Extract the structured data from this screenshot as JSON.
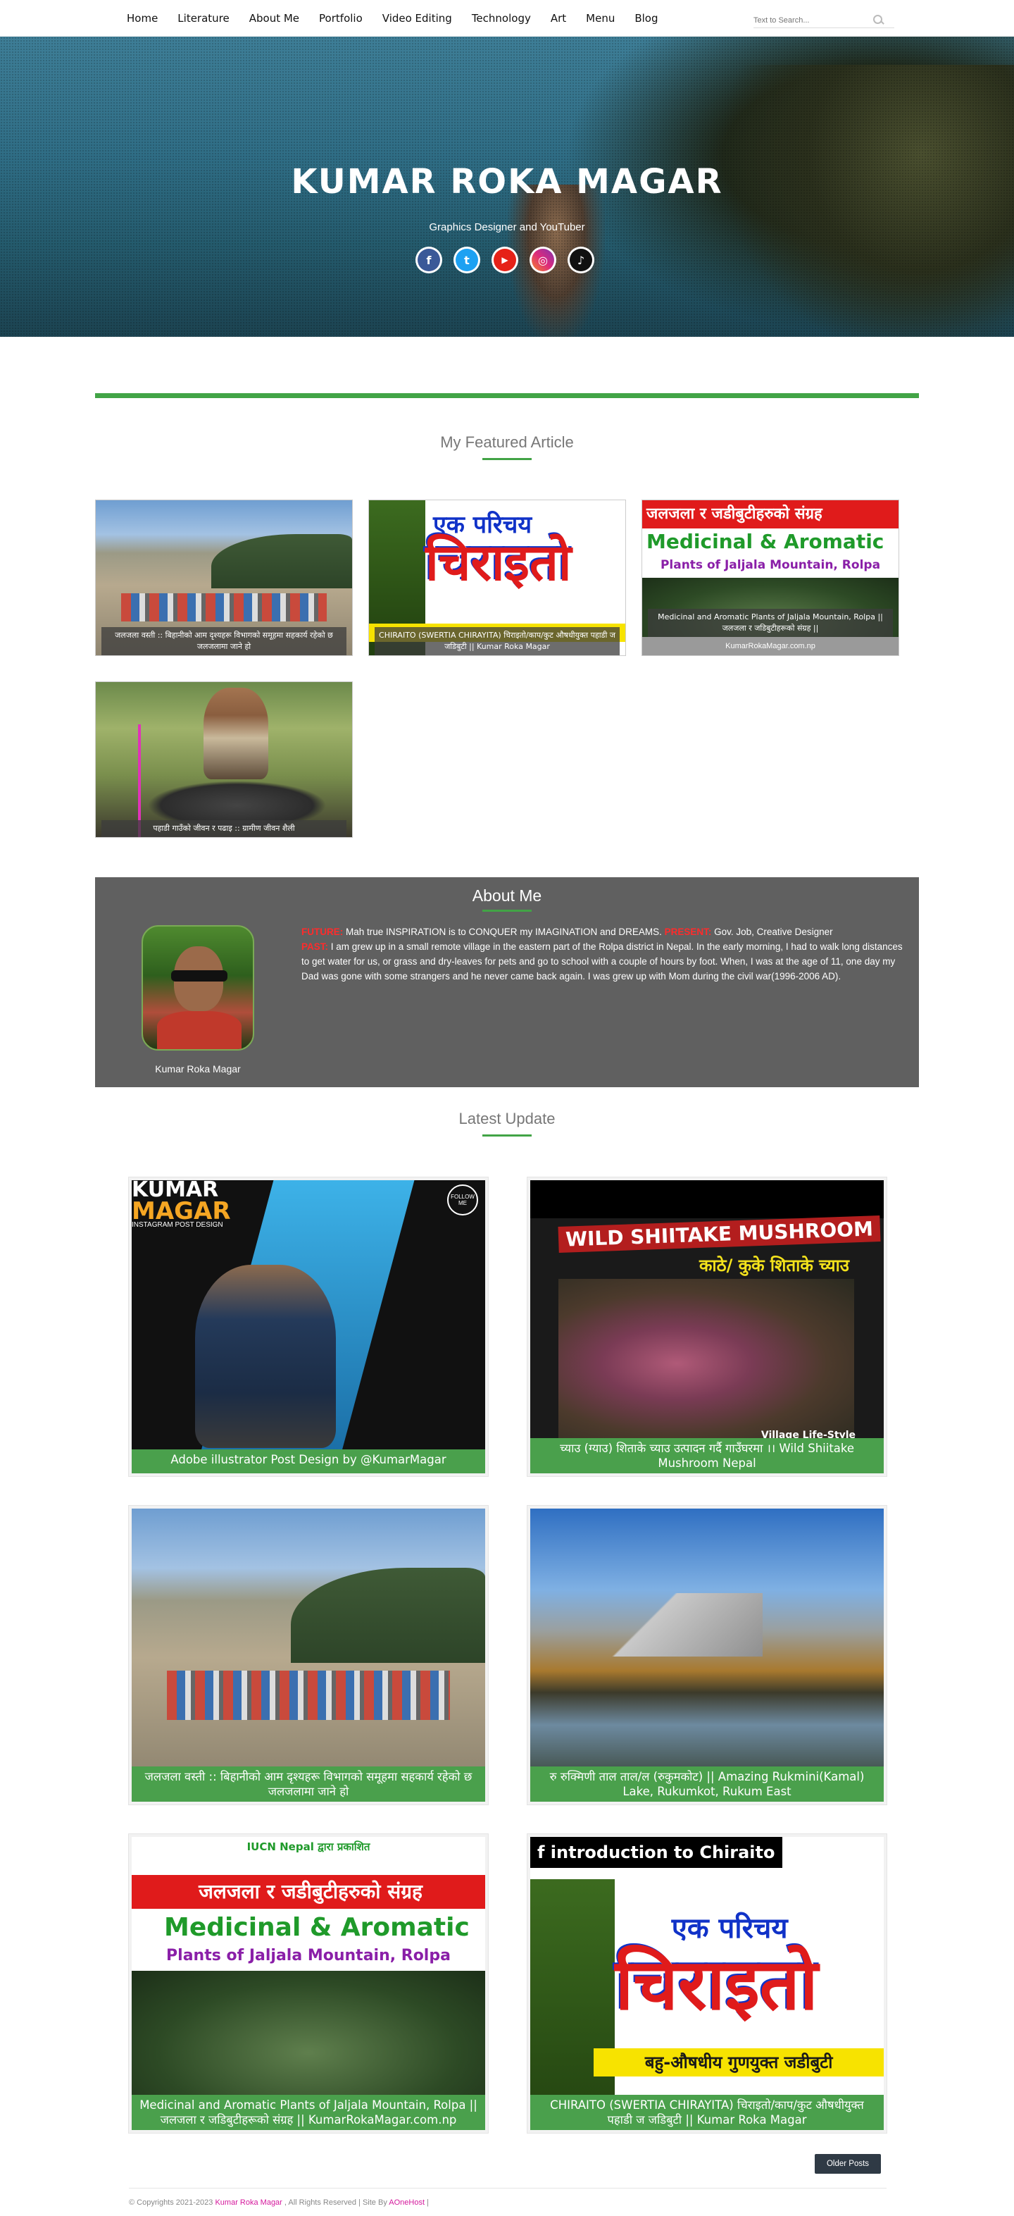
{
  "nav": {
    "items": [
      "Home",
      "Literature",
      "About Me",
      "Portfolio",
      "Video Editing",
      "Technology",
      "Art",
      "Menu",
      "Blog"
    ],
    "search_placeholder": "Text to Search..."
  },
  "hero": {
    "title": "KUMAR ROKA MAGAR",
    "tagline": "Graphics Designer and YouTuber",
    "socials": [
      {
        "name": "facebook",
        "glyph": "f",
        "color": "#3b5998"
      },
      {
        "name": "twitter",
        "glyph": "t",
        "color": "#1da1f2"
      },
      {
        "name": "youtube",
        "glyph": "▶",
        "color": "#e62117"
      },
      {
        "name": "instagram",
        "glyph": "◎",
        "color": "#c13584"
      },
      {
        "name": "tiktok",
        "glyph": "♪",
        "color": "#111111"
      }
    ]
  },
  "featured": {
    "title": "My Featured Article",
    "cards": [
      {
        "caption": "जलजला वस्ती :: बिहानीको आम दृश्यहरू विभागको समूहमा सहकार्य रहेको छ जलजलामा जाने हो"
      },
      {
        "caption": "CHIRAITO (SWERTIA CHIRAYITA) चिराइतो/काप/कुट औषधीयुक्त पहाडी ज जडिबुटी || Kumar Roka Magar"
      },
      {
        "caption": "Medicinal and Aromatic Plants of Jaljala Mountain, Rolpa || जलजला र जडिबुटीहरूको संग्रह ||",
        "url": "KumarRokaMagar.com.np",
        "banner": "जलजला र जडीबुटीहरुको संग्रह",
        "heading": "Medicinal & Aromatic",
        "subheading": "Plants of Jaljala Mountain, Rolpa"
      },
      {
        "caption": "पहाडी गाउँको जीवन र पढाइ :: ग्रामीण जीवन शैली"
      }
    ],
    "chiraito_top": "एक परिचय",
    "chiraito_big": "चिराइतो"
  },
  "about": {
    "title": "About Me",
    "name": "Kumar Roka Magar",
    "future_label": "FUTURE:",
    "future_text": " Mah true INSPIRATION is to CONQUER my IMAGINATION and DREAMS. ",
    "present_label": "PRESENT:",
    "present_text": " Gov. Job, Creative Designer ",
    "past_label": "PAST:",
    "past_text": " I am grew up in a small remote village in the eastern part of the Rolpa district in Nepal. In the early morning, I had to walk long distances to get water for us, or grass and dry-leaves for pets and go to school with a couple of hours by foot. When, I was at the age of 11, one day my Dad was gone with some strangers and he never came back again. I was grew up with Mom during the civil war(1996-2006 AD)."
  },
  "latest": {
    "title": "Latest Update",
    "posts": [
      {
        "caption": "Adobe illustrator Post Design by @KumarMagar",
        "kumar": "KUMAR",
        "magar": "MAGAR",
        "sub": "INSTAGRAM POST DESIGN",
        "follow": "FOLLOW ME"
      },
      {
        "caption": "च्याउ (ग्याउ) शिताके च्याउ उत्पादन गर्दै गाउँघरमा ।। Wild Shiitake Mushroom Nepal",
        "headline": "WILD SHIITAKE MUSHROOM",
        "sub": "काठे/ कुके शिताके च्याउ",
        "tag": "Village Life-Style"
      },
      {
        "caption": "जलजला वस्ती :: बिहानीको आम दृश्यहरू विभागको समूहमा सहकार्य रहेको छ जलजलामा जाने हो",
        "kind": "meadow"
      },
      {
        "caption": "रु रुक्मिणी ताल ताल/ल (रुकुमकोट) || Amazing Rukmini(Kamal) Lake, Rukumkot, Rukum East",
        "kind": "lake"
      },
      {
        "caption": "Medicinal and Aromatic Plants of Jaljala Mountain, Rolpa || जलजला र जडिबुटीहरूको संग्रह || KumarRokaMagar.com.np",
        "iucn": "IUCN Nepal द्वारा प्रकाशित"
      },
      {
        "caption": "CHIRAITO (SWERTIA CHIRAYITA) चिराइतो/काप/कुट औषधीयुक्त पहाडी ज जडिबुटी || Kumar Roka Magar",
        "intro": "f introduction to Chiraito",
        "bottom": "बहु-औषधीय गुणयुक्त जडीबुटी"
      }
    ],
    "older": "Older Posts"
  },
  "footer": {
    "prefix": "© Copyrights 2021-2023 ",
    "owner": "Kumar Roka Magar",
    "middle": " , All Rights Reserved | Site By ",
    "site": "AOneHost",
    "suffix": " |"
  }
}
